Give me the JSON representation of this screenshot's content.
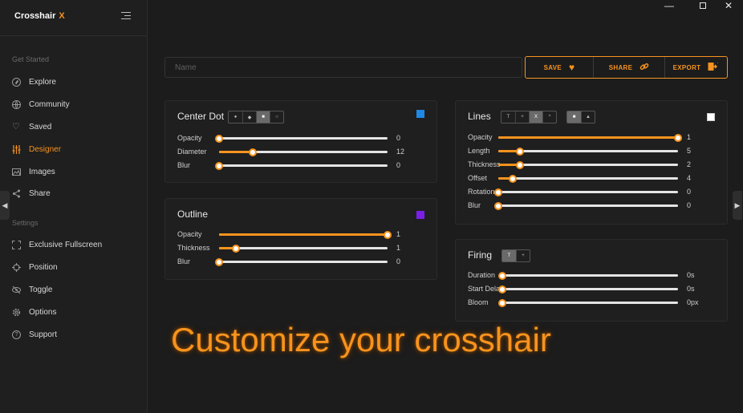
{
  "app": {
    "brand_name": "Crosshair",
    "brand_suffix": "X"
  },
  "window_controls": {
    "minimize": "—",
    "close": "✕"
  },
  "sidebar": {
    "section_get_started": "Get Started",
    "section_settings": "Settings",
    "get_started_items": [
      {
        "label": "Explore",
        "icon": "compass-icon"
      },
      {
        "label": "Community",
        "icon": "globe-icon"
      },
      {
        "label": "Saved",
        "icon": "heart-icon"
      },
      {
        "label": "Designer",
        "icon": "sliders-icon",
        "active": true
      },
      {
        "label": "Images",
        "icon": "image-icon"
      },
      {
        "label": "Share",
        "icon": "share-icon"
      }
    ],
    "settings_items": [
      {
        "label": "Exclusive Fullscreen",
        "icon": "fullscreen-icon"
      },
      {
        "label": "Position",
        "icon": "crosshair-icon"
      },
      {
        "label": "Toggle",
        "icon": "eye-off-icon"
      },
      {
        "label": "Options",
        "icon": "gear-icon"
      },
      {
        "label": "Support",
        "icon": "help-icon"
      }
    ]
  },
  "topbar": {
    "name_placeholder": "Name",
    "save_label": "SAVE",
    "share_label": "SHARE",
    "export_label": "EXPORT"
  },
  "center_dot": {
    "title": "Center Dot",
    "color": "#1e88e5",
    "shapes": [
      "dot",
      "diamond",
      "square",
      "circle"
    ],
    "selected_shape": "square",
    "sliders": [
      {
        "label": "Opacity",
        "value": "0",
        "level": 0.0
      },
      {
        "label": "Diameter",
        "value": "12",
        "level": 0.2
      },
      {
        "label": "Blur",
        "value": "0",
        "level": 0.0
      }
    ]
  },
  "outline": {
    "title": "Outline",
    "color": "#7b1fe8",
    "sliders": [
      {
        "label": "Opacity",
        "value": "1",
        "level": 1.0
      },
      {
        "label": "Thickness",
        "value": "1",
        "level": 0.1
      },
      {
        "label": "Blur",
        "value": "0",
        "level": 0.0
      }
    ]
  },
  "lines": {
    "title": "Lines",
    "color": "#ffffff",
    "styles": [
      "T",
      "+",
      "X",
      "^",
      "■",
      "▲"
    ],
    "sliders": [
      {
        "label": "Opacity",
        "value": "1",
        "level": 1.0
      },
      {
        "label": "Length",
        "value": "5",
        "level": 0.12
      },
      {
        "label": "Thickness",
        "value": "2",
        "level": 0.12
      },
      {
        "label": "Offset",
        "value": "4",
        "level": 0.08
      },
      {
        "label": "Rotation",
        "value": "0",
        "level": 0.0
      },
      {
        "label": "Blur",
        "value": "0",
        "level": 0.0
      }
    ]
  },
  "firing": {
    "title": "Firing",
    "modes": [
      "T",
      "+"
    ],
    "sliders": [
      {
        "label": "Duration",
        "value": "0s",
        "level": 0.0
      },
      {
        "label": "Start Delay",
        "value": "0s",
        "level": 0.0
      },
      {
        "label": "Bloom",
        "value": "0px",
        "level": 0.0
      }
    ]
  },
  "banner": {
    "text": "Customize your crosshair"
  },
  "colors": {
    "accent": "#f7931e",
    "background": "#1c1c1c",
    "panel": "#1f1f1f"
  }
}
